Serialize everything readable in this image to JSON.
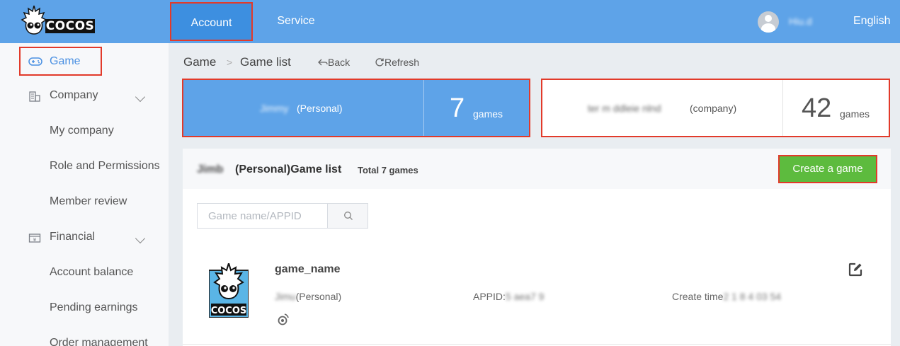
{
  "header": {
    "logo_text": "COCOS",
    "nav": [
      {
        "label": "Account",
        "active": true
      },
      {
        "label": "Service",
        "active": false
      }
    ],
    "username": "Hiu.d",
    "language": "English",
    "colors": {
      "bar": "#5ea3e8",
      "active_tab": "#3d8fe0",
      "highlight_outline": "#e23a2a"
    }
  },
  "sidebar": {
    "items": [
      {
        "label": "Game",
        "icon": "gamepad-icon",
        "active": true
      },
      {
        "label": "Company",
        "icon": "building-icon",
        "expandable": true
      },
      {
        "label": "My company"
      },
      {
        "label": "Role and Permissions"
      },
      {
        "label": "Member review"
      },
      {
        "label": "Financial",
        "icon": "yen-register-icon",
        "expandable": true
      },
      {
        "label": "Account balance"
      },
      {
        "label": "Pending earnings"
      },
      {
        "label": "Order management"
      }
    ]
  },
  "breadcrumb": {
    "items": [
      "Game",
      "Game list"
    ],
    "separator": ">",
    "back_label": "Back",
    "refresh_label": "Refresh"
  },
  "cards": {
    "personal": {
      "name": "Jimmy",
      "suffix": "(Personal)",
      "count": "7",
      "unit": "games"
    },
    "company": {
      "name": "ter m ddleie nlnd",
      "suffix": "(company)",
      "count": "42",
      "unit": "games"
    }
  },
  "game_list": {
    "owner": "Jimb",
    "title": "(Personal)Game list",
    "total": "Total 7 games",
    "create_label": "Create a game",
    "create_color": "#5dbb3e",
    "search_placeholder": "Game name/APPID",
    "games": [
      {
        "name": "game_name",
        "owner_name": "Jimu",
        "owner_suffix": "(Personal)",
        "appid_label": "APPID:",
        "appid_value": "5 aea7 9",
        "create_label": "Create time",
        "create_value": "2 1 8 4 03 54"
      }
    ]
  }
}
